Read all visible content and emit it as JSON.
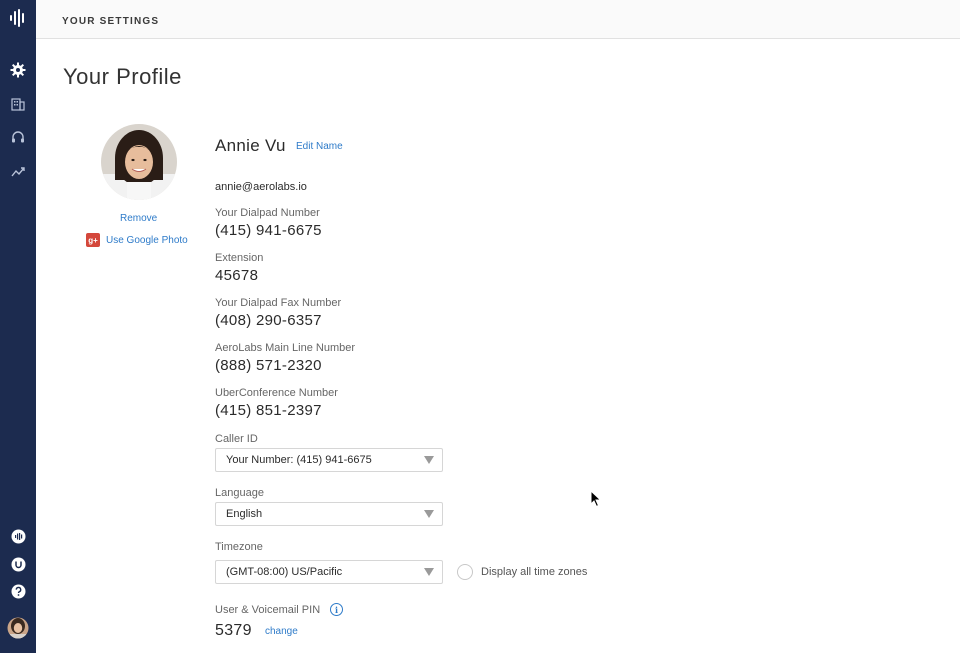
{
  "header": {
    "title": "YOUR SETTINGS"
  },
  "page": {
    "title": "Your Profile"
  },
  "sidebar": {
    "top_items": [
      {
        "icon": "logo-icon"
      },
      {
        "icon": "gear-icon"
      },
      {
        "icon": "building-icon"
      },
      {
        "icon": "headset-icon"
      },
      {
        "icon": "analytics-icon"
      }
    ],
    "bottom_items": [
      {
        "icon": "dialpad-app-icon"
      },
      {
        "icon": "uberconference-icon"
      },
      {
        "icon": "help-icon"
      },
      {
        "icon": "user-avatar"
      }
    ]
  },
  "profile": {
    "name": "Annie Vu",
    "edit_name_label": "Edit Name",
    "email": "annie@aerolabs.io",
    "remove_photo_label": "Remove",
    "google_photo_label": "Use Google Photo",
    "google_badge": "g+"
  },
  "fields": [
    {
      "label": "Your Dialpad Number",
      "value": "(415) 941-6675"
    },
    {
      "label": "Extension",
      "value": "45678"
    },
    {
      "label": "Your Dialpad Fax Number",
      "value": "(408) 290-6357"
    },
    {
      "label": "AeroLabs Main Line Number",
      "value": "(888) 571-2320"
    },
    {
      "label": "UberConference Number",
      "value": "(415) 851-2397"
    }
  ],
  "caller_id": {
    "label": "Caller ID",
    "selected": "Your Number: (415) 941-6675"
  },
  "language": {
    "label": "Language",
    "selected": "English"
  },
  "timezone": {
    "label": "Timezone",
    "selected": "(GMT-08:00) US/Pacific",
    "display_all_label": "Display all time zones",
    "display_all_checked": false
  },
  "pin": {
    "label": "User & Voicemail PIN",
    "info_glyph": "i",
    "value": "5379",
    "change_label": "change"
  },
  "colors": {
    "sidebar": "#1c2b4f",
    "link": "#2e7bc9",
    "google": "#d4473b"
  }
}
